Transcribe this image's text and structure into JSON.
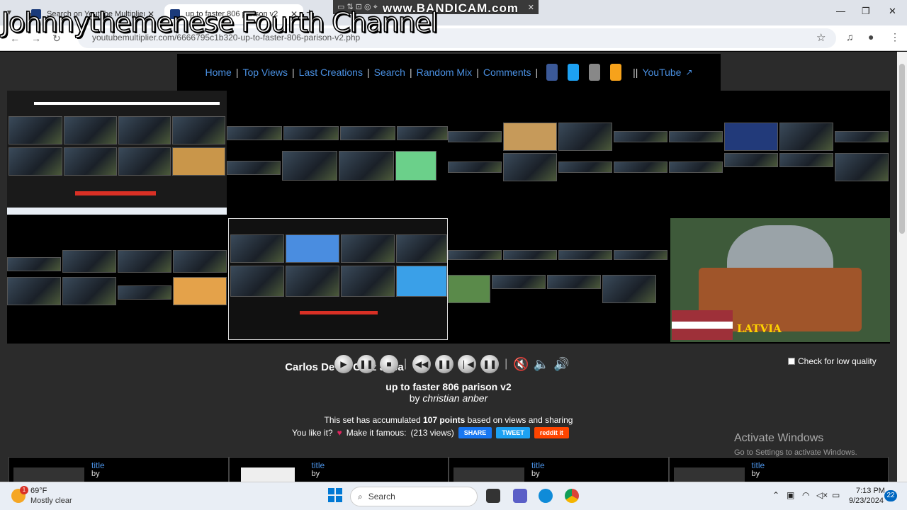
{
  "watermark": "Johnnythemenese Fourth Channel",
  "browser": {
    "tabs": [
      {
        "title": "Search on Youtube Multiplier",
        "active": false
      },
      {
        "title": "up to faster 806 parison v2",
        "active": true
      }
    ],
    "url": "youtubemultiplier.com/6666795c1b320-up-to-faster-806-parison-v2.php",
    "bandicam": "www.BANDICAM.com"
  },
  "nav": {
    "items": [
      "Home",
      "Top Views",
      "Last Creations",
      "Search",
      "Random Mix",
      "Comments"
    ],
    "youtube": "YouTube"
  },
  "mosaic": {
    "caption": "Carlos De La Cruz Japa",
    "latvia": "LATVIA"
  },
  "player": {
    "low_quality": "Check for low quality"
  },
  "set": {
    "title": "up to faster 806 parison v2",
    "by_prefix": "by",
    "author": "christian anber",
    "points_before": "This set has accumulated",
    "points": "107 points",
    "points_after": "based on views and sharing",
    "like_prefix": "You like it?",
    "like_mid": "Make it famous:",
    "views": "(213 views)",
    "share": "SHARE",
    "tweet": "TWEET",
    "reddit": "reddit it"
  },
  "windows_notice": {
    "line1": "Activate Windows",
    "line2": "Go to Settings to activate Windows."
  },
  "cards": [
    {
      "title": "title",
      "by": "by"
    },
    {
      "title": "title",
      "by": "by"
    },
    {
      "title": "title",
      "by": "by"
    },
    {
      "title": "title",
      "by": "by"
    }
  ],
  "taskbar": {
    "temp": "69°F",
    "condition": "Mostly clear",
    "search": "Search",
    "time": "7:13 PM",
    "date": "9/23/2024",
    "notifications": "22",
    "weather_badge": "1"
  }
}
